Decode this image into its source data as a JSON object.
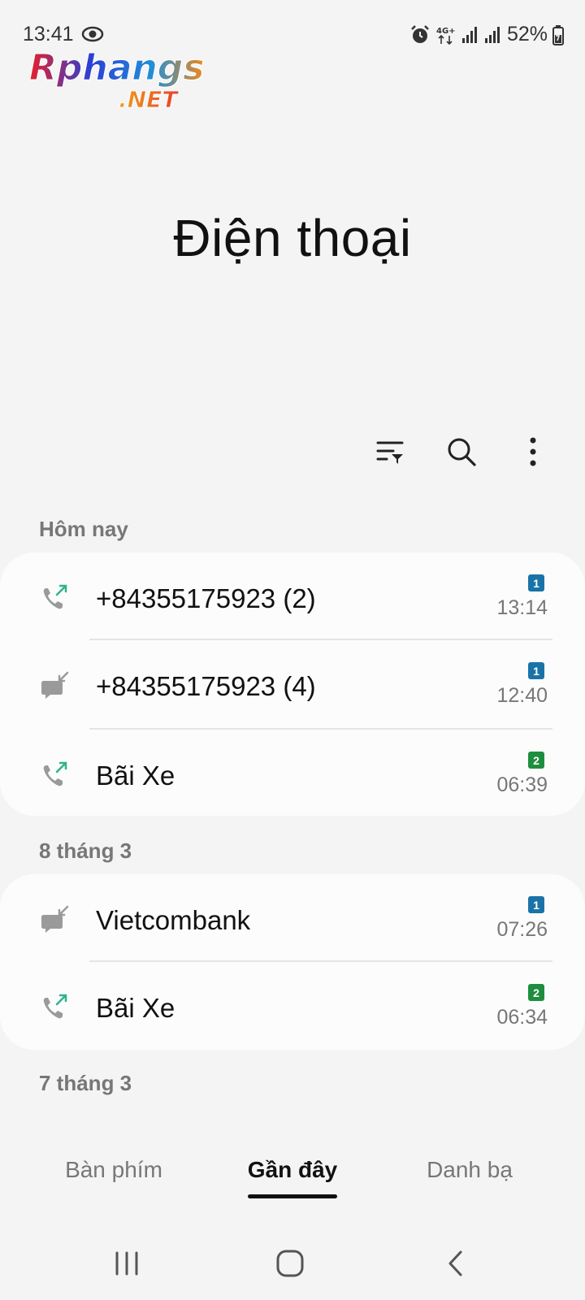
{
  "status_bar": {
    "time": "13:41",
    "network": "4G+",
    "battery": "52%"
  },
  "watermark": {
    "line1": "Rphangs",
    "line2": ".NET"
  },
  "header": {
    "title": "Điện thoại"
  },
  "toolbar": {
    "icons": [
      "filter-icon",
      "search-icon",
      "more-icon"
    ]
  },
  "sections": [
    {
      "label": "Hôm nay",
      "items": [
        {
          "name": "+84355175923 (2)",
          "sim": "1",
          "sim_color": "#1a73a8",
          "time": "13:14",
          "type": "outgoing"
        },
        {
          "name": "+84355175923 (4)",
          "sim": "1",
          "sim_color": "#1a73a8",
          "time": "12:40",
          "type": "incoming-message"
        },
        {
          "name": "Bãi Xe",
          "sim": "2",
          "sim_color": "#1e8e3e",
          "time": "06:39",
          "type": "outgoing"
        }
      ]
    },
    {
      "label": "8 tháng 3",
      "items": [
        {
          "name": "Vietcombank",
          "sim": "1",
          "sim_color": "#1a73a8",
          "time": "07:26",
          "type": "incoming-message"
        },
        {
          "name": "Bãi Xe",
          "sim": "2",
          "sim_color": "#1e8e3e",
          "time": "06:34",
          "type": "outgoing"
        }
      ]
    },
    {
      "label": "7 tháng 3",
      "items": []
    }
  ],
  "tabs": [
    {
      "label": "Bàn phím",
      "active": false
    },
    {
      "label": "Gần đây",
      "active": true
    },
    {
      "label": "Danh bạ",
      "active": false
    }
  ]
}
